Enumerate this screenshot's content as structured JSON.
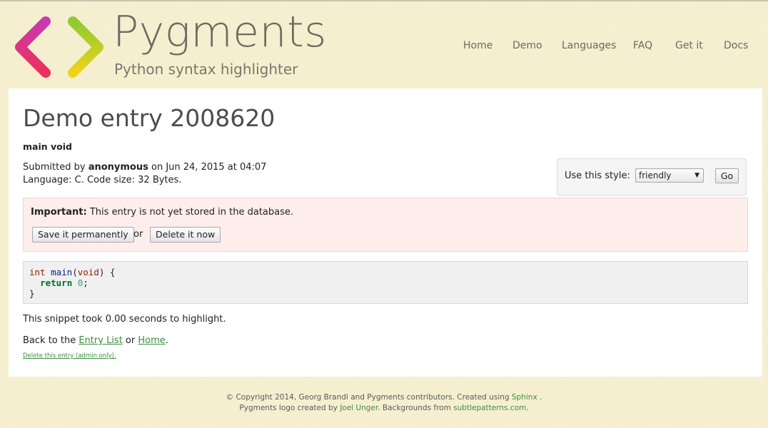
{
  "brand": {
    "title": "Pygments",
    "subtitle": "Python syntax highlighter",
    "logo_icon": "angle-brackets-logo"
  },
  "nav": {
    "items": [
      {
        "label": "Home"
      },
      {
        "label": "Demo"
      },
      {
        "label": "Languages"
      },
      {
        "label": "FAQ"
      },
      {
        "label": "Get it"
      },
      {
        "label": "Docs"
      }
    ]
  },
  "entry": {
    "page_title": "Demo entry 2008620",
    "name": "main void",
    "submitted_prefix": "Submitted by ",
    "author": "anonymous",
    "submitted_suffix": " on Jun 24, 2015 at 04:07",
    "language_line": "Language: C. Code size: 32 Bytes."
  },
  "style_picker": {
    "label": "Use this style:",
    "selected": "friendly",
    "go_label": "Go"
  },
  "alert": {
    "strong": "Important:",
    "text": " This entry is not yet stored in the database.",
    "save_label": "Save it permanently",
    "or_text": "or",
    "delete_label": "Delete it now"
  },
  "code": {
    "line1": {
      "kt": "int",
      "sp1": " ",
      "nf": "main",
      "p1": "(",
      "kt2": "void",
      "p2": ") {"
    },
    "line2": {
      "indent": "  ",
      "kw": "return",
      "sp": " ",
      "mi": "0",
      "end": ";"
    },
    "line3": "}"
  },
  "timing": "This snippet took 0.00 seconds to highlight.",
  "back": {
    "prefix": "Back to the ",
    "entry_list": "Entry List",
    "middle": " or ",
    "home": "Home",
    "suffix": "."
  },
  "admin_delete": "Delete this entry (admin only).",
  "footer": {
    "line1_prefix": "© Copyright 2014, Georg Brandl and Pygments contributors. Created using ",
    "sphinx": "Sphinx",
    "line1_suffix": " .",
    "line2_prefix": "Pygments logo created by ",
    "joel": "Joel Unger",
    "line2_middle": ". Backgrounds from ",
    "subtle": "subtlepatterns.com",
    "line2_suffix": "."
  },
  "colors": {
    "background": "#f5efcf",
    "link": "#3e8e3e",
    "alert_bg": "#fdeeec",
    "code_bg": "#f0f0f0"
  }
}
